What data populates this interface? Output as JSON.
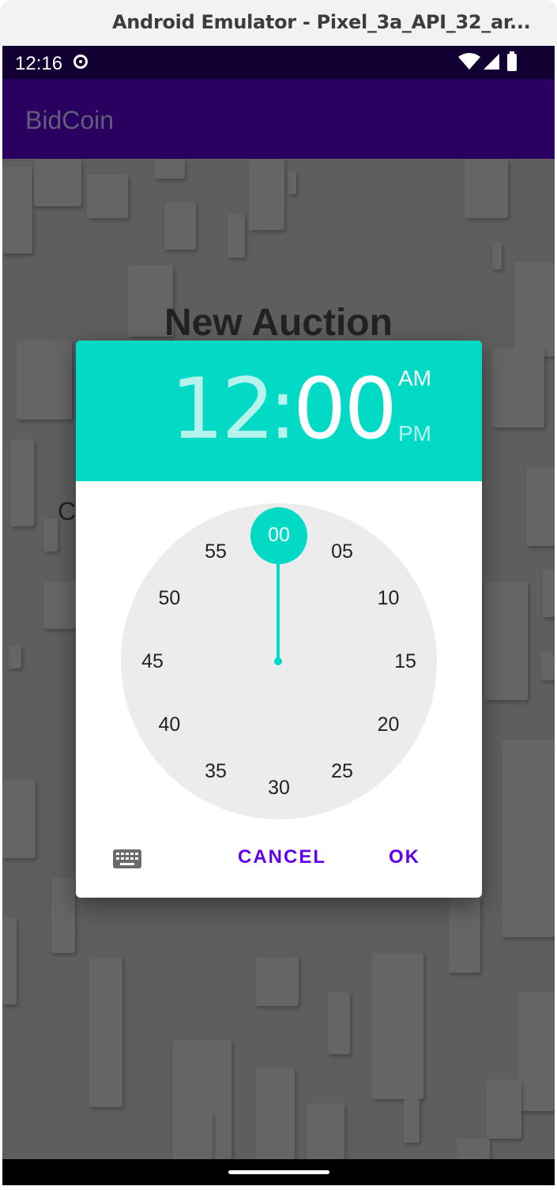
{
  "window": {
    "title": "Android Emulator - Pixel_3a_API_32_ar..."
  },
  "status_bar": {
    "time": "12:16",
    "icons": [
      "media-icon",
      "wifi-icon",
      "signal-icon",
      "battery-icon"
    ]
  },
  "app_bar": {
    "title": "BidCoin"
  },
  "page": {
    "heading": "New Auction",
    "field_fragment": "C"
  },
  "time_picker": {
    "hour": "12",
    "separator": ":",
    "minute": "00",
    "am_label": "AM",
    "pm_label": "PM",
    "selected_period": "AM",
    "minute_labels": [
      "00",
      "05",
      "10",
      "15",
      "20",
      "25",
      "30",
      "35",
      "40",
      "45",
      "50",
      "55"
    ],
    "selected_minute": "00",
    "cancel_label": "CANCEL",
    "ok_label": "OK",
    "colors": {
      "header": "#03dac5",
      "accent": "#6200ee"
    }
  }
}
